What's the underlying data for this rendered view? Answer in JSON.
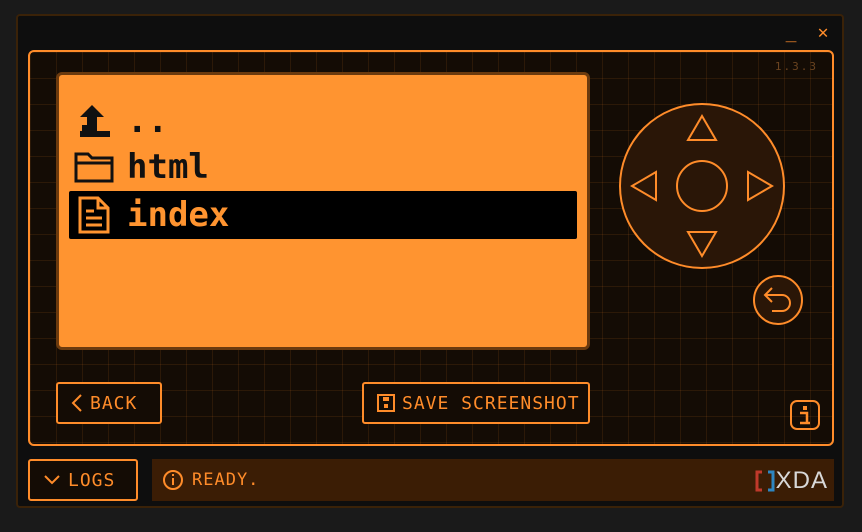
{
  "window": {
    "minimize_glyph": "_",
    "close_glyph": "✕"
  },
  "device": {
    "version": "1.3.3"
  },
  "file_list": [
    {
      "name": "..",
      "icon": "parent-folder-icon",
      "selected": false
    },
    {
      "name": "html",
      "icon": "folder-icon",
      "selected": false
    },
    {
      "name": "index",
      "icon": "file-icon",
      "selected": true
    }
  ],
  "buttons": {
    "back_label": "BACK",
    "save_label": "SAVE SCREENSHOT",
    "logs_label": "LOGS"
  },
  "status": {
    "text": "READY."
  },
  "watermark": {
    "text": "XDA"
  },
  "colors": {
    "accent": "#ff8c2a",
    "screen": "#ff9430",
    "status_bg": "#3b1d05"
  }
}
